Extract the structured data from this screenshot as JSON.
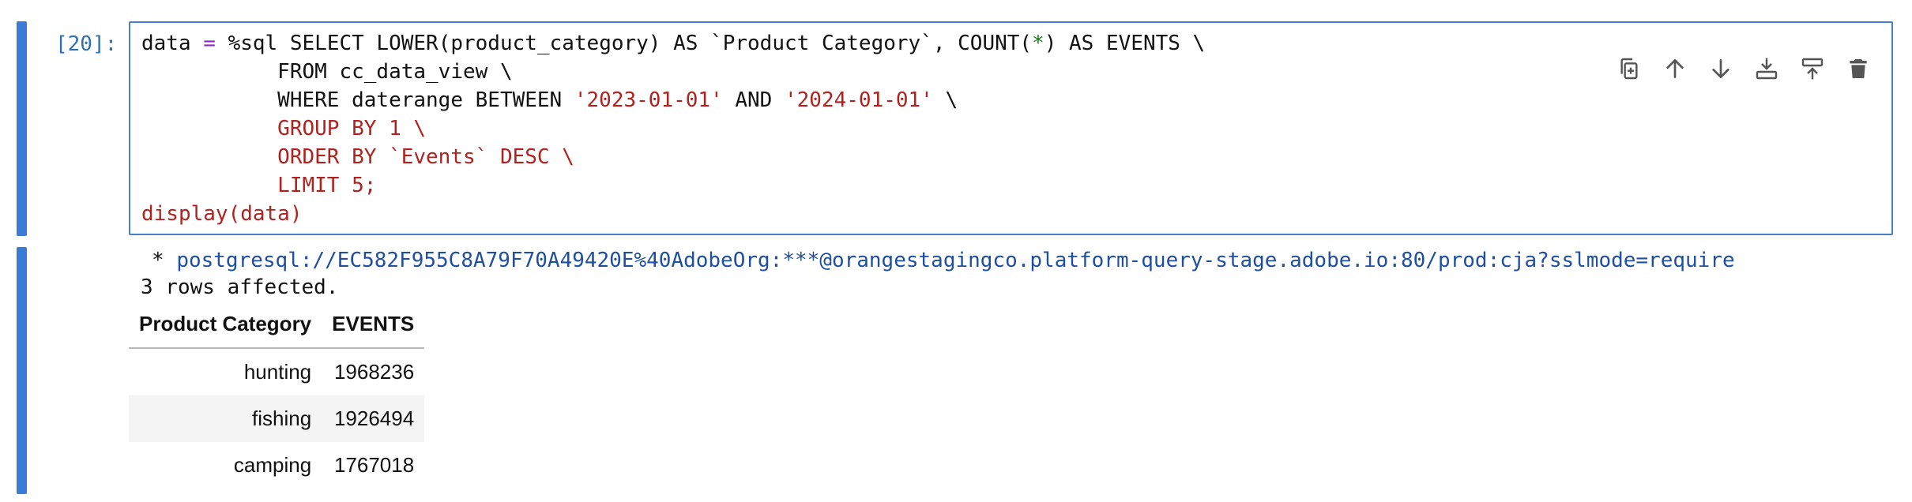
{
  "cell": {
    "prompt": "[20]:",
    "code": {
      "l1_a": "data ",
      "l1_eq": "=",
      "l1_b": " %sql SELECT LOWER(product_category) AS `Product Category`, COUNT(",
      "l1_star": "*",
      "l1_c": ") AS EVENTS \\",
      "l2": "           FROM cc_data_view \\",
      "l3_a": "           WHERE daterange BETWEEN ",
      "l3_s1": "'2023-01-01'",
      "l3_b": " AND ",
      "l3_s2": "'2024-01-01'",
      "l3_c": " \\",
      "l4": "           GROUP BY 1 \\",
      "l5": "           ORDER BY `Events` DESC \\",
      "l6": "           LIMIT 5;",
      "l7": "display(data)"
    },
    "toolbar": {
      "duplicate": "copy-icon",
      "up": "arrow-up-icon",
      "down": "arrow-down-icon",
      "insert_above": "insert-above-icon",
      "insert_below": "insert-below-icon",
      "delete": "trash-icon"
    }
  },
  "output": {
    "connection_star": " * ",
    "connection_url": "postgresql://EC582F955C8A79F70A49420E%40AdobeOrg:***@orangestagingco.platform-query-stage.adobe.io:80/prod:cja?sslmode=require",
    "rows_affected": "3 rows affected.",
    "table": {
      "headers": [
        "Product Category",
        "EVENTS"
      ],
      "rows": [
        [
          "hunting",
          "1968236"
        ],
        [
          "fishing",
          "1926494"
        ],
        [
          "camping",
          "1767018"
        ]
      ]
    }
  },
  "colors": {
    "collapser": "#3a7bd5",
    "editor_border": "#4a7fc8",
    "string": "#b0221f",
    "url": "#1f4fa0"
  }
}
